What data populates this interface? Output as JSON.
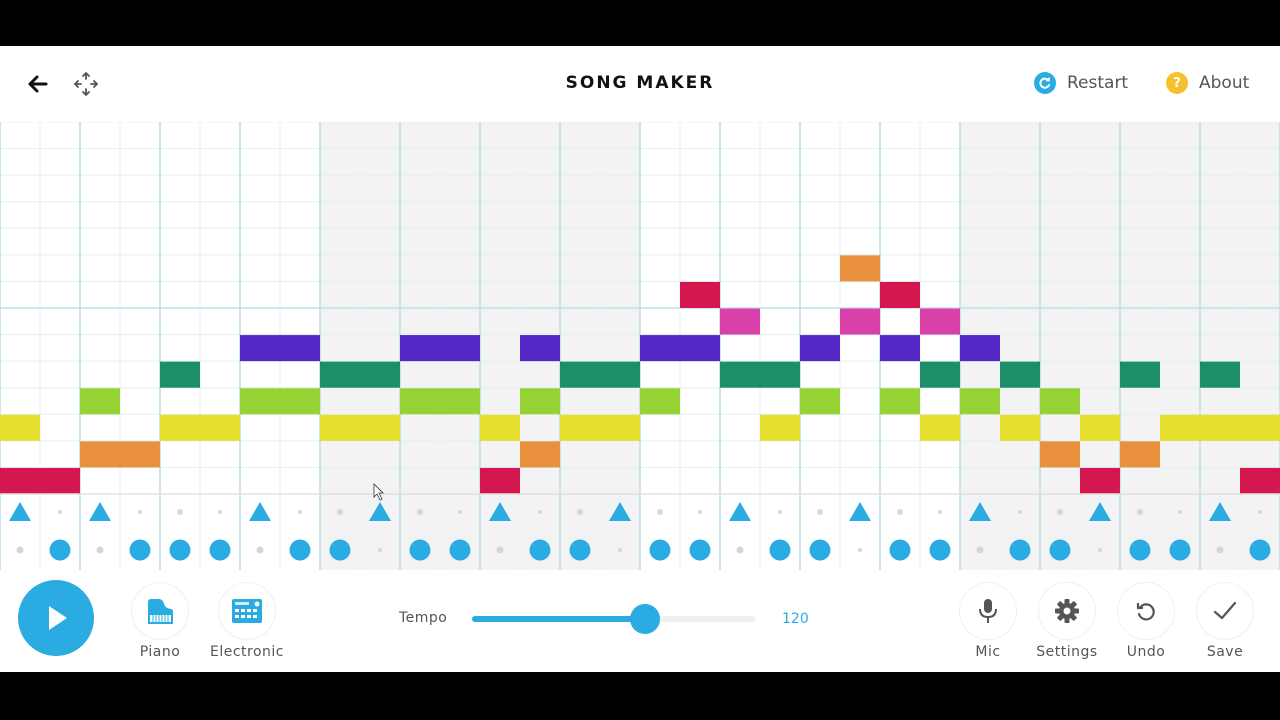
{
  "header": {
    "title": "SONG MAKER",
    "back_icon": "arrow-left-icon",
    "move_icon": "move-arrows-icon",
    "restart": {
      "label": "Restart",
      "icon": "restart-icon",
      "color": "#2aace2"
    },
    "about": {
      "label": "About",
      "icon": "question-icon",
      "color": "#f5c12e"
    }
  },
  "grid": {
    "columns": 32,
    "melody_rows": 14,
    "beats_per_bar": 2,
    "shaded_measures": [
      1,
      3
    ],
    "octave_line_row": 7,
    "note_colors": [
      "#d4174e",
      "#e8903c",
      "#e4df2c",
      "#95d335",
      "#1b8f6a",
      "#5527c4",
      "#d940a8",
      "#d4174e",
      "#e8903c"
    ],
    "melody_notes_by_column": [
      [
        2,
        0
      ],
      [
        0
      ],
      [
        3,
        1
      ],
      [
        1
      ],
      [
        4,
        2
      ],
      [
        2
      ],
      [
        5,
        3
      ],
      [
        5,
        3
      ],
      [
        4,
        2
      ],
      [
        4,
        2
      ],
      [
        5,
        3
      ],
      [
        5,
        3
      ],
      [
        2,
        0
      ],
      [
        5,
        3,
        1
      ],
      [
        4,
        2
      ],
      [
        4,
        2
      ],
      [
        5,
        3
      ],
      [
        7,
        5
      ],
      [
        6,
        4
      ],
      [
        4,
        2
      ],
      [
        5,
        3
      ],
      [
        8,
        6
      ],
      [
        7,
        5,
        3
      ],
      [
        6,
        4,
        2
      ],
      [
        5,
        3
      ],
      [
        4,
        2
      ],
      [
        3,
        1
      ],
      [
        2,
        0
      ],
      [
        4,
        1
      ],
      [
        2
      ],
      [
        4,
        2
      ],
      [
        2,
        0
      ]
    ],
    "percussion": {
      "color": "#2aace2",
      "triangle_columns": [
        0,
        2,
        6,
        9,
        12,
        15,
        18,
        21,
        24,
        27,
        30
      ],
      "circle_columns": [
        1,
        3,
        4,
        5,
        7,
        8,
        10,
        11,
        13,
        14,
        16,
        17,
        19,
        20,
        22,
        23,
        25,
        26,
        28,
        29,
        31
      ]
    }
  },
  "toolbar": {
    "play_icon": "play-icon",
    "instruments": [
      {
        "label": "Piano",
        "icon": "piano-icon"
      },
      {
        "label": "Electronic",
        "icon": "drum-machine-icon"
      }
    ],
    "tempo": {
      "label": "Tempo",
      "value": "120",
      "fraction": 0.61
    },
    "actions": [
      {
        "label": "Mic",
        "icon": "mic-icon"
      },
      {
        "label": "Settings",
        "icon": "gear-icon"
      },
      {
        "label": "Undo",
        "icon": "undo-icon"
      },
      {
        "label": "Save",
        "icon": "check-icon"
      }
    ]
  }
}
